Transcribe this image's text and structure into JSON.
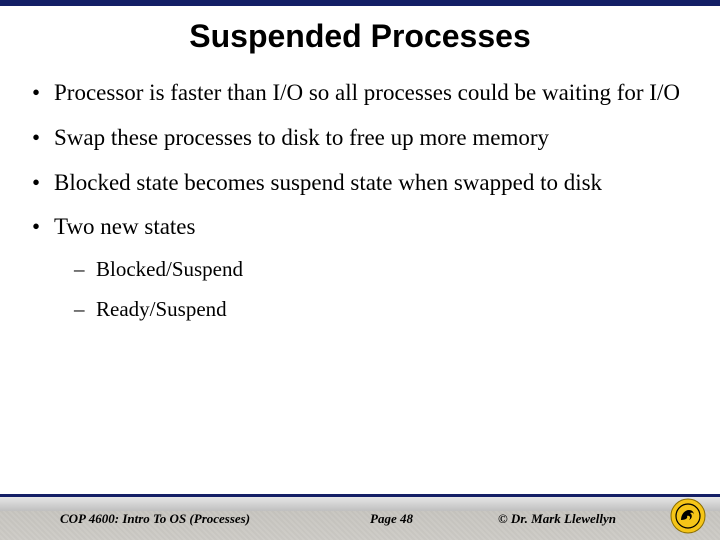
{
  "title": "Suspended Processes",
  "bullets": [
    {
      "text": "Processor is faster than I/O so all processes could be waiting for I/O"
    },
    {
      "text": "Swap these processes to disk to free up more memory"
    },
    {
      "text": "Blocked state becomes suspend state when swapped to disk"
    },
    {
      "text": "Two new states",
      "sub": [
        {
          "text": "Blocked/Suspend"
        },
        {
          "text": "Ready/Suspend"
        }
      ]
    }
  ],
  "footer": {
    "course": "COP 4600: Intro To OS  (Processes)",
    "page": "Page 48",
    "author": "© Dr. Mark Llewellyn"
  },
  "logo": {
    "name": "ucf-pegasus-seal"
  }
}
